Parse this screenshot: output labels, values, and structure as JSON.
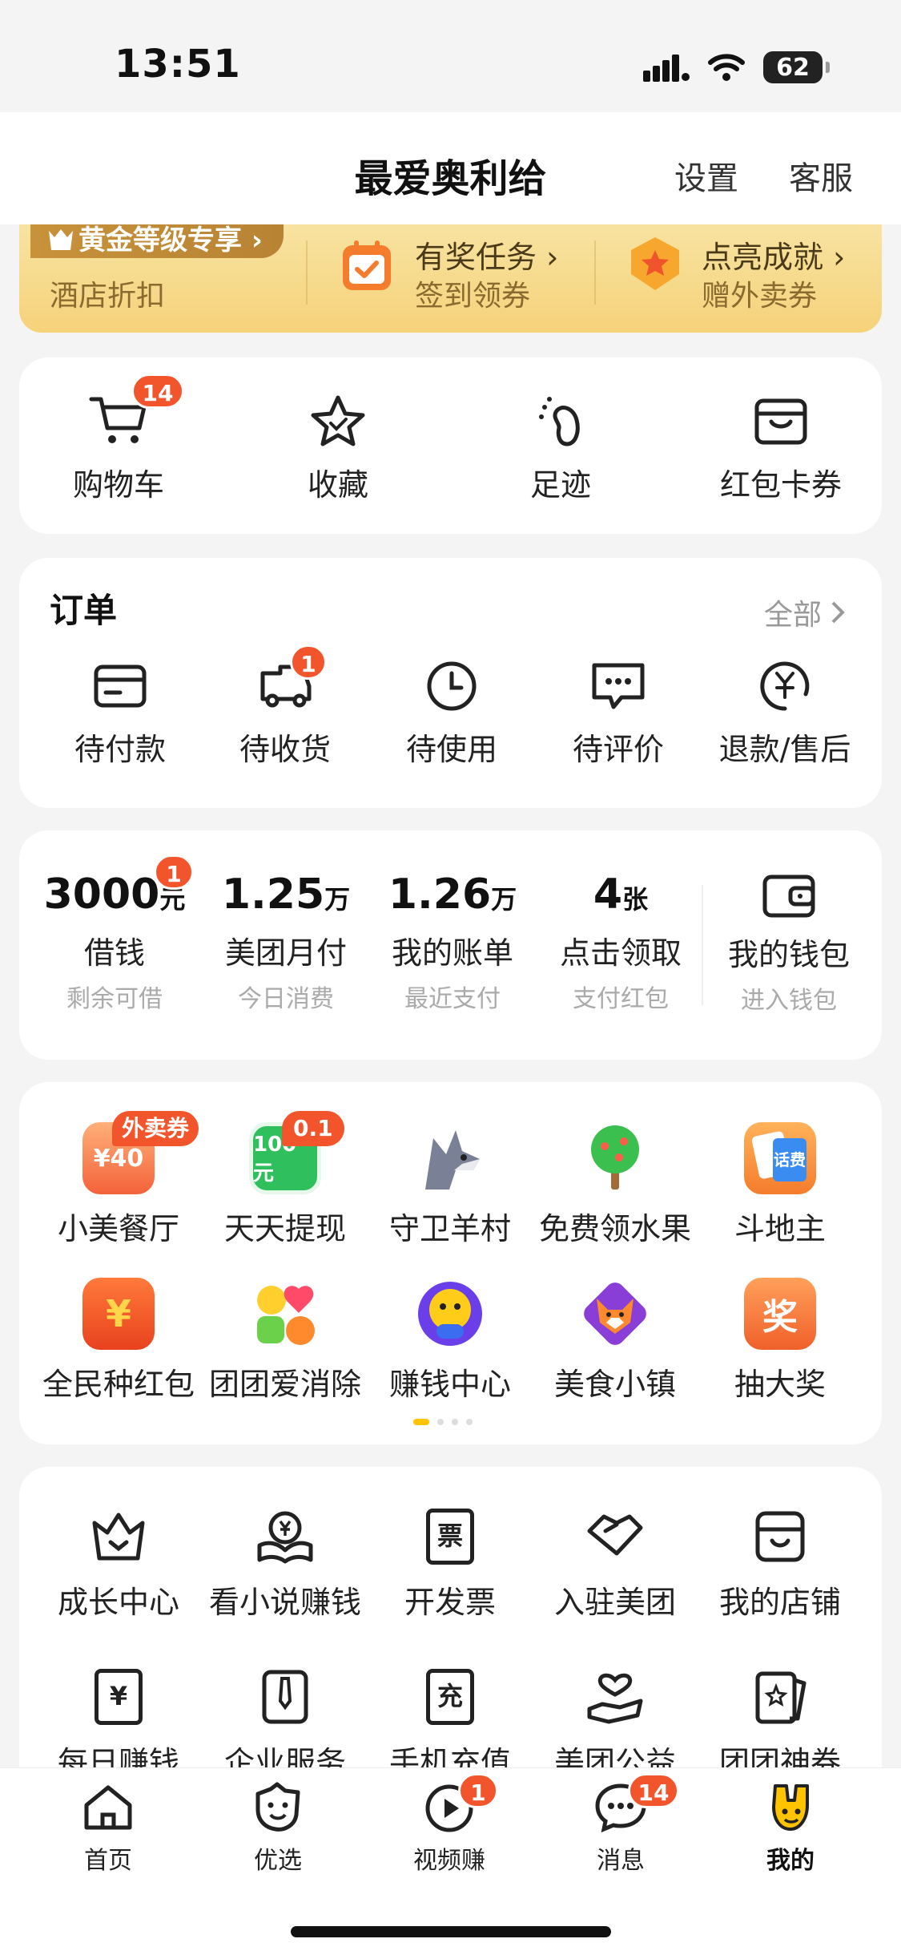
{
  "status": {
    "time": "13:51",
    "battery": "62"
  },
  "header": {
    "title": "最爱奥利给",
    "settings": "设置",
    "service": "客服"
  },
  "gold_banner": {
    "chip": "黄金等级专享 ›",
    "hotel": "酒店折扣",
    "task_title": "有奖任务 ›",
    "task_sub": "签到领券",
    "ach_title": "点亮成就 ›",
    "ach_sub": "赠外卖券"
  },
  "quick": {
    "cart": "购物车",
    "cart_badge": "14",
    "favorites": "收藏",
    "footprint": "足迹",
    "coupons": "红包卡券"
  },
  "orders": {
    "title": "订单",
    "all": "全部",
    "items": [
      "待付款",
      "待收货",
      "待使用",
      "待评价",
      "退款/售后"
    ],
    "receive_badge": "1"
  },
  "finance": {
    "loan_value": "3000",
    "loan_unit": "元",
    "loan_badge": "1",
    "loan_label": "借钱",
    "loan_sub": "剩余可借",
    "monthly_value": "1.25",
    "monthly_unit": "万",
    "monthly_label": "美团月付",
    "monthly_sub": "今日消费",
    "bill_value": "1.26",
    "bill_unit": "万",
    "bill_label": "我的账单",
    "bill_sub": "最近支付",
    "redpack_value": "4",
    "redpack_unit": "张",
    "redpack_label": "点击领取",
    "redpack_sub": "支付红包",
    "wallet_label": "我的钱包",
    "wallet_sub": "进入钱包"
  },
  "apps": {
    "row1": [
      "小美餐厅",
      "天天提现",
      "守卫羊村",
      "免费领水果",
      "斗地主"
    ],
    "row2": [
      "全民种红包",
      "团团爱消除",
      "赚钱中心",
      "美食小镇",
      "抽大奖"
    ],
    "tag_waimai": "外卖券",
    "tag_cash": "0.1",
    "icon_text_40": "¥40",
    "icon_text_100": "100元",
    "icon_text_yuan": "¥",
    "icon_text_jiang": "奖",
    "icon_text_huafei": "话费"
  },
  "services": {
    "row1": [
      "成长中心",
      "看小说赚钱",
      "开发票",
      "入驻美团",
      "我的店铺"
    ],
    "row2": [
      "每日赚钱",
      "企业服务",
      "手机充值",
      "美团公益",
      "团团神券"
    ],
    "invoice_char": "票",
    "recharge_char": "充",
    "yen_char": "¥"
  },
  "tabbar": {
    "home": "首页",
    "youxuan": "优选",
    "video": "视频赚",
    "video_badge": "1",
    "messages": "消息",
    "messages_badge": "14",
    "mine": "我的"
  },
  "colors": {
    "accent": "#f2552c",
    "gold": "#f6d27a",
    "brand_yellow": "#ffc300"
  }
}
